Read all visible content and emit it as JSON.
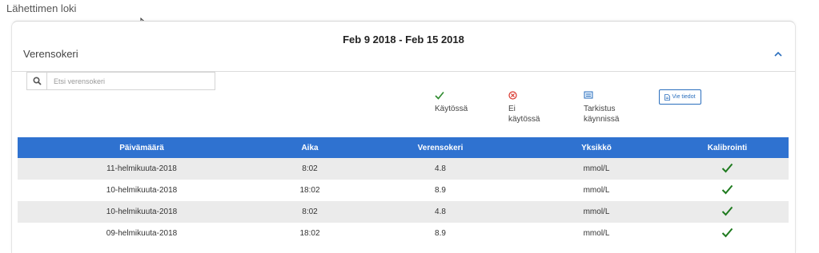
{
  "page": {
    "title": "Lähettimen loki"
  },
  "card": {
    "date_range": "Feb 9 2018 - Feb 15 2018",
    "section_title": "Verensokeri"
  },
  "search": {
    "placeholder": "Etsi verensokeri",
    "value": ""
  },
  "legend": [
    {
      "icon": "check-icon",
      "label": "Käytössä",
      "color": "#2e8b2e"
    },
    {
      "icon": "not-in-use-icon",
      "label": "Ei käytössä",
      "color": "#d9342b"
    },
    {
      "icon": "check-in-progress-icon",
      "label": "Tarkistus käynnissä",
      "color": "#2a6ebd"
    }
  ],
  "export_button": {
    "label": "Vie tiedot",
    "icon": "document-icon"
  },
  "table": {
    "headers": [
      "Päivämäärä",
      "Aika",
      "Verensokeri",
      "Yksikkö",
      "Kalibrointi"
    ],
    "rows": [
      {
        "date": "11-helmikuuta-2018",
        "time": "8:02",
        "value": "4.8",
        "unit": "mmol/L",
        "calibration": "check-icon"
      },
      {
        "date": "10-helmikuuta-2018",
        "time": "18:02",
        "value": "8.9",
        "unit": "mmol/L",
        "calibration": "check-icon"
      },
      {
        "date": "10-helmikuuta-2018",
        "time": "8:02",
        "value": "4.8",
        "unit": "mmol/L",
        "calibration": "check-icon"
      },
      {
        "date": "09-helmikuuta-2018",
        "time": "18:02",
        "value": "8.9",
        "unit": "mmol/L",
        "calibration": "check-icon"
      }
    ]
  },
  "colors": {
    "header_blue": "#2f72d0",
    "check_green": "#2e8b2e"
  }
}
